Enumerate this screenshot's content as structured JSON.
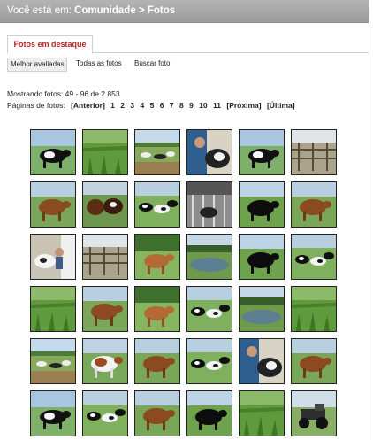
{
  "breadcrumb": {
    "prefix": "Você está em:",
    "section": "Comunidade",
    "sep": ">",
    "page": "Fotos"
  },
  "tabs": {
    "featured": "Fotos em destaque"
  },
  "subtabs": {
    "best_rated": "Melhor avaliadas",
    "all_photos": "Todas as fotos",
    "search": "Buscar foto"
  },
  "status": {
    "showing": "Mostrando fotos: 49 - 96 de 2.853",
    "pages_label": "Páginas de fotos:"
  },
  "pagination": {
    "prev": "[Anterior]",
    "pages": [
      "1",
      "2",
      "3",
      "4",
      "5",
      "6",
      "7",
      "8",
      "9",
      "10",
      "11"
    ],
    "next": "[Próxima]",
    "last": "[Última]"
  },
  "photos": [
    {
      "scene": "cow-black-white"
    },
    {
      "scene": "grass-field"
    },
    {
      "scene": "herd-field"
    },
    {
      "scene": "person-cow"
    },
    {
      "scene": "cow-black-white"
    },
    {
      "scene": "fence-yard"
    },
    {
      "scene": "cow-brown"
    },
    {
      "scene": "cows-brown-group"
    },
    {
      "scene": "cows-black-white-group"
    },
    {
      "scene": "milking-barn"
    },
    {
      "scene": "cow-black"
    },
    {
      "scene": "cow-brown"
    },
    {
      "scene": "person-cow-white"
    },
    {
      "scene": "fence-yard"
    },
    {
      "scene": "cow-brown-field"
    },
    {
      "scene": "pond-trees"
    },
    {
      "scene": "cow-black"
    },
    {
      "scene": "cows-black-white-group"
    },
    {
      "scene": "grass-field"
    },
    {
      "scene": "cow-brown"
    },
    {
      "scene": "cow-brown-field"
    },
    {
      "scene": "cows-black-white-group"
    },
    {
      "scene": "pond-trees"
    },
    {
      "scene": "grass-field"
    },
    {
      "scene": "herd-field"
    },
    {
      "scene": "cow-brown-white"
    },
    {
      "scene": "cow-brown"
    },
    {
      "scene": "cows-black-white-group"
    },
    {
      "scene": "person-cow"
    },
    {
      "scene": "cow-brown"
    },
    {
      "scene": "cow-black-white"
    },
    {
      "scene": "cows-black-white-group"
    },
    {
      "scene": "cow-brown"
    },
    {
      "scene": "cow-black"
    },
    {
      "scene": "grass-field"
    },
    {
      "scene": "tractor"
    }
  ],
  "colors": {
    "header_bg": "#a5a5a5",
    "tab_text": "#b22222",
    "accent_link": "#222222"
  }
}
